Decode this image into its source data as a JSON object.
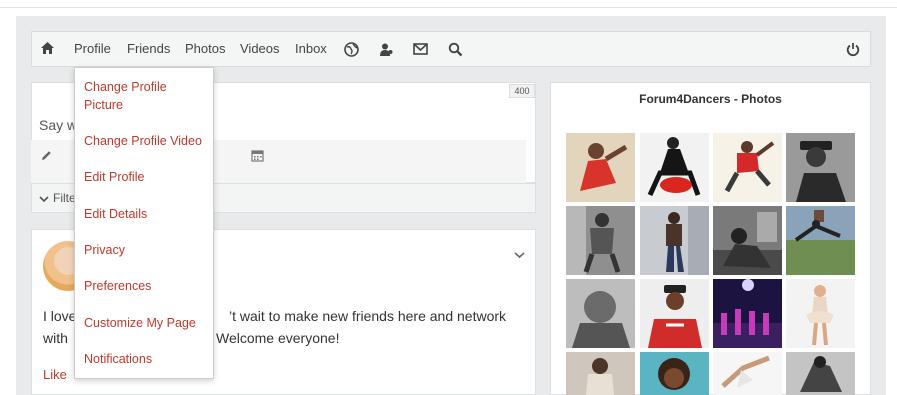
{
  "nav": {
    "links": [
      "Profile",
      "Friends",
      "Photos",
      "Videos",
      "Inbox"
    ],
    "icons": [
      "home-icon",
      "globe-icon",
      "users-icon",
      "mail-icon",
      "search-icon",
      "power-icon"
    ]
  },
  "composer": {
    "placeholder": "Say w",
    "char_limit": "400"
  },
  "filter": {
    "label": "Filte"
  },
  "profile_menu": {
    "items": [
      "Change Profile Picture",
      "Change Profile Video",
      "Edit Profile",
      "Edit Details",
      "Privacy",
      "Preferences",
      "Customize My Page",
      "Notifications"
    ]
  },
  "post": {
    "line1_part1": "I love",
    "line1_part2": "’t wait to make new friends here and network",
    "line2_part1": "with",
    "line2_part2": "Welcome everyone!",
    "like_label": "Like"
  },
  "photos": {
    "title": "Forum4Dancers - Photos"
  },
  "colors": {
    "link_red": "#c0392b",
    "frame_bg": "#e8eaeb",
    "nav_bg": "#f4f5f5"
  }
}
